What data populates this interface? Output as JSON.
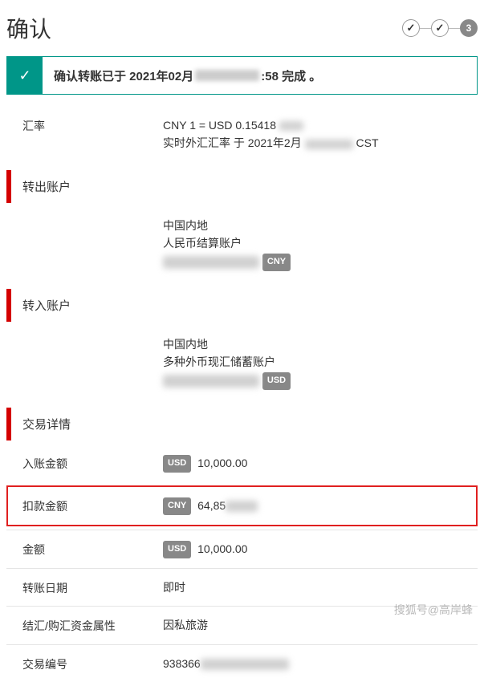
{
  "header": {
    "title": "确认",
    "step3": "3"
  },
  "banner": {
    "prefix": "确认转账已于 2021年02月",
    "suffix": ":58 完成 。"
  },
  "rate": {
    "label": "汇率",
    "line1": "CNY 1 = USD 0.15418",
    "line2_prefix": "实时外汇汇率 于 2021年2月",
    "line2_suffix": "CST"
  },
  "sections": {
    "from": "转出账户",
    "to": "转入账户",
    "detail": "交易详情"
  },
  "from": {
    "region": "中国内地",
    "acct_type": "人民币结算账户",
    "curr": "CNY"
  },
  "to": {
    "region": "中国内地",
    "acct_type": "多种外币现汇储蓄账户",
    "curr": "USD"
  },
  "detail": {
    "credit_label": "入账金额",
    "credit_curr": "USD",
    "credit_val": "10,000.00",
    "debit_label": "扣款金额",
    "debit_curr": "CNY",
    "debit_val": "64,85",
    "amount_label": "金额",
    "amount_curr": "USD",
    "amount_val": "10,000.00",
    "date_label": "转账日期",
    "date_val": "即时",
    "purpose_label": "结汇/购汇资金属性",
    "purpose_val": "因私旅游",
    "txn_label": "交易编号",
    "txn_val": "938366"
  },
  "watermark": "搜狐号@高岸蜂"
}
